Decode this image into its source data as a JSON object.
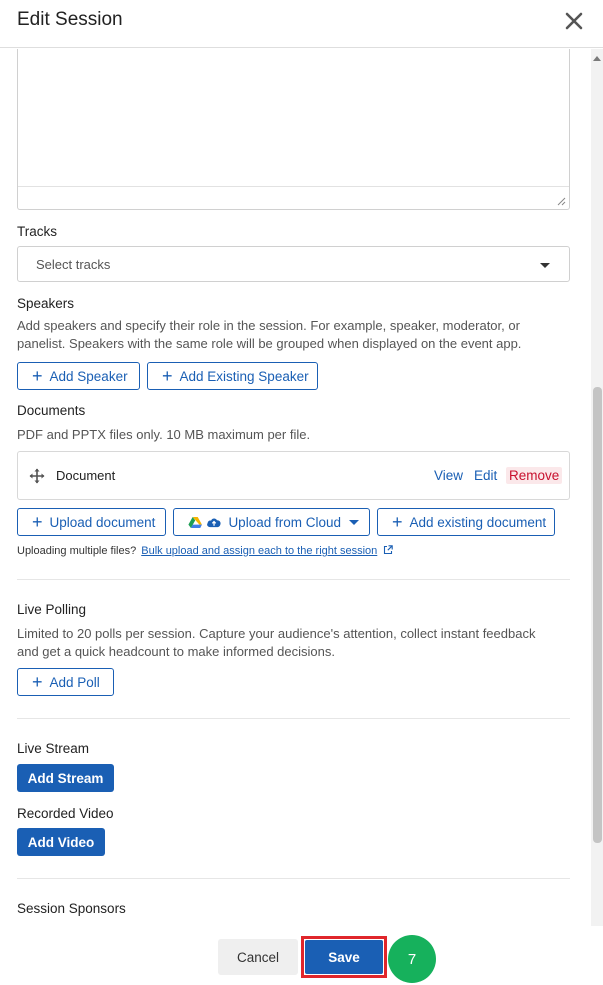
{
  "header": {
    "title": "Edit Session"
  },
  "tracks": {
    "label": "Tracks",
    "placeholder": "Select tracks"
  },
  "speakers": {
    "label": "Speakers",
    "description": "Add speakers and specify their role in the session. For example, speaker, moderator, or panelist. Speakers with the same role will be grouped when displayed on the event app.",
    "add_speaker": "Add Speaker",
    "add_existing_speaker": "Add Existing Speaker"
  },
  "documents": {
    "label": "Documents",
    "description": "PDF and PPTX files only. 10 MB maximum per file.",
    "item_name": "Document",
    "view": "View",
    "edit": "Edit",
    "remove": "Remove",
    "upload_document": "Upload document",
    "upload_from_cloud": "Upload from Cloud",
    "add_existing_document": "Add existing document",
    "note": "Uploading multiple files?",
    "note_link": "Bulk upload and assign each to the right session"
  },
  "live_polling": {
    "label": "Live Polling",
    "description": "Limited to 20 polls per session. Capture your audience's attention, collect instant feedback and get a quick headcount to make informed decisions.",
    "add_poll": "Add Poll"
  },
  "live_stream": {
    "label": "Live Stream",
    "add_stream": "Add Stream"
  },
  "recorded_video": {
    "label": "Recorded Video",
    "add_video": "Add Video"
  },
  "session_sponsors": {
    "label": "Session Sponsors"
  },
  "footer": {
    "cancel": "Cancel",
    "save": "Save",
    "step": "7"
  },
  "colors": {
    "primary": "#1a5fb4",
    "danger": "#c8102e",
    "step_badge": "#16b15c",
    "highlight": "#e0262b"
  }
}
